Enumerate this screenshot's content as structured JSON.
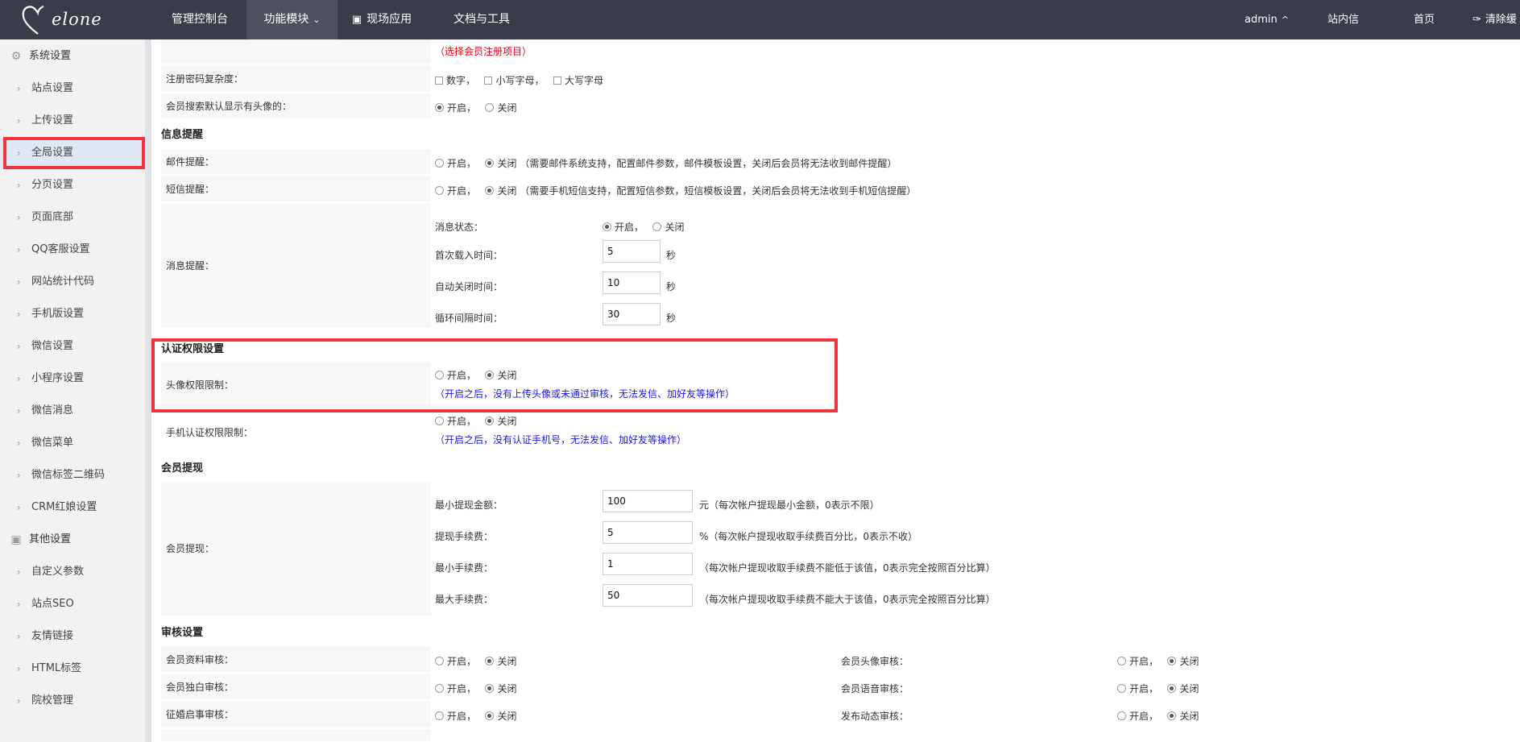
{
  "app": {
    "logo_text": "elone",
    "nav": [
      "管理控制台",
      "功能模块",
      "现场应用",
      "文档与工具"
    ],
    "user": "admin",
    "top_links": [
      "站内信",
      "首页",
      "清除缓"
    ]
  },
  "sidebar": {
    "group1": "系统设置",
    "items1": [
      "站点设置",
      "上传设置",
      "全局设置",
      "分页设置",
      "页面底部",
      "QQ客服设置",
      "网站统计代码",
      "手机版设置",
      "微信设置",
      "小程序设置",
      "微信消息",
      "微信菜单",
      "微信标签二维码",
      "CRM红娘设置"
    ],
    "group2": "其他设置",
    "items2": [
      "自定义参数",
      "站点SEO",
      "友情链接",
      "HTML标签",
      "院校管理"
    ]
  },
  "main": {
    "top_hint": "（选择会员注册项目）",
    "pwd_label": "注册密码复杂度：",
    "pwd_opts": [
      "数字，",
      "小写字母，",
      "大写字母"
    ],
    "avatar_search_label": "会员搜索默认显示有头像的：",
    "on": "开启，",
    "off": "关闭",
    "sec_notify": "信息提醒",
    "mail_label": "邮件提醒：",
    "mail_hint": "（需要邮件系统支持，配置邮件参数，邮件模板设置，关闭后会员将无法收到邮件提醒）",
    "sms_label": "短信提醒：",
    "sms_hint": "（需要手机短信支持，配置短信参数，短信模板设置，关闭后会员将无法收到手机短信提醒）",
    "msg_label": "消息提醒：",
    "msg_state": "消息状态：",
    "msg_first": "首次载入时间：",
    "msg_first_val": "5",
    "msg_close": "自动关闭时间：",
    "msg_close_val": "10",
    "msg_loop": "循环间隔时间：",
    "msg_loop_val": "30",
    "sec_unit": "秒",
    "sec_auth": "认证权限设置",
    "auth_avatar_label": "头像权限限制：",
    "auth_avatar_hint": "（开启之后，没有上传头像或未通过审核，无法发信、加好友等操作）",
    "auth_phone_label": "手机认证权限限制：",
    "auth_phone_hint": "（开启之后，没有认证手机号，无法发信、加好友等操作）",
    "sec_withdraw": "会员提现",
    "withdraw_label": "会员提现：",
    "w_min": "最小提现金额：",
    "w_min_val": "100",
    "w_min_hint": "元（每次帐户提现最小金额，0表示不限）",
    "w_fee": "提现手续费：",
    "w_fee_val": "5",
    "w_fee_hint": "%（每次帐户提现收取手续费百分比，0表示不收）",
    "w_minfee": "最小手续费：",
    "w_minfee_val": "1",
    "w_minfee_hint": "（每次帐户提现收取手续费不能低于该值，0表示完全按照百分比算）",
    "w_maxfee": "最大手续费：",
    "w_maxfee_val": "50",
    "w_maxfee_hint": "（每次帐户提现收取手续费不能大于该值，0表示完全按照百分比算）",
    "sec_audit": "审核设置",
    "audit_left": [
      "会员资料审核：",
      "会员独白审核：",
      "征婚启事审核："
    ],
    "audit_right": [
      "会员头像审核：",
      "会员语音审核：",
      "发布动态审核："
    ]
  }
}
